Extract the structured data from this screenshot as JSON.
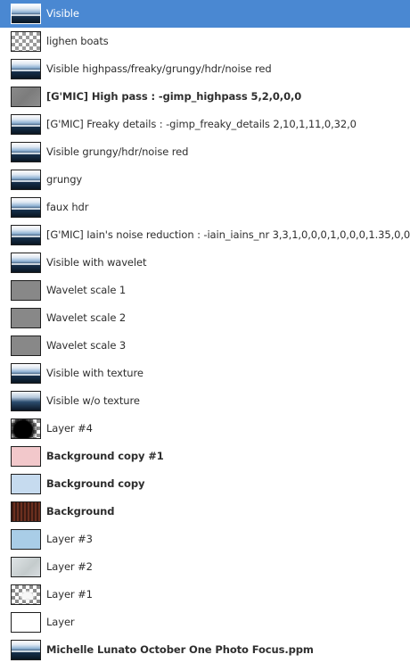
{
  "layers": [
    {
      "name": "Visible",
      "bold": false,
      "selected": true,
      "thumb": "t-photo"
    },
    {
      "name": "lighen boats",
      "bold": false,
      "selected": false,
      "thumb": "t-check"
    },
    {
      "name": "Visible highpass/freaky/grungy/hdr/noise red",
      "bold": false,
      "selected": false,
      "thumb": "t-photo"
    },
    {
      "name": "[G'MIC] High pass : -gimp_highpass 5,2,0,0,0",
      "bold": true,
      "selected": false,
      "thumb": "t-gray-noise"
    },
    {
      "name": "[G'MIC] Freaky details : -gimp_freaky_details 2,10,1,11,0,32,0",
      "bold": false,
      "selected": false,
      "thumb": "t-photo"
    },
    {
      "name": "Visible grungy/hdr/noise red",
      "bold": false,
      "selected": false,
      "thumb": "t-photo"
    },
    {
      "name": "grungy",
      "bold": false,
      "selected": false,
      "thumb": "t-photo"
    },
    {
      "name": "faux hdr",
      "bold": false,
      "selected": false,
      "thumb": "t-photo"
    },
    {
      "name": "[G'MIC] Iain's noise reduction : -iain_iains_nr 3,3,1,0,0,0,1,0,0,0,1.35,0,0",
      "bold": false,
      "selected": false,
      "thumb": "t-photo"
    },
    {
      "name": "Visible with wavelet",
      "bold": false,
      "selected": false,
      "thumb": "t-photo"
    },
    {
      "name": "Wavelet scale 1",
      "bold": false,
      "selected": false,
      "thumb": "t-gray"
    },
    {
      "name": "Wavelet scale 2",
      "bold": false,
      "selected": false,
      "thumb": "t-gray"
    },
    {
      "name": "Wavelet scale 3",
      "bold": false,
      "selected": false,
      "thumb": "t-gray"
    },
    {
      "name": "Visible with texture",
      "bold": false,
      "selected": false,
      "thumb": "t-photo"
    },
    {
      "name": "Visible w/o texture",
      "bold": false,
      "selected": false,
      "thumb": "t-dark-photo"
    },
    {
      "name": "Layer #4",
      "bold": false,
      "selected": false,
      "thumb": "t-blackcheck"
    },
    {
      "name": "Background copy #1",
      "bold": true,
      "selected": false,
      "thumb": "t-pink"
    },
    {
      "name": "Background copy",
      "bold": true,
      "selected": false,
      "thumb": "t-lightblue"
    },
    {
      "name": "Background",
      "bold": true,
      "selected": false,
      "thumb": "t-bark"
    },
    {
      "name": "Layer #3",
      "bold": false,
      "selected": false,
      "thumb": "t-sky"
    },
    {
      "name": "Layer #2",
      "bold": false,
      "selected": false,
      "thumb": "t-mist"
    },
    {
      "name": "Layer #1",
      "bold": false,
      "selected": false,
      "thumb": "t-cloudcheck"
    },
    {
      "name": "Layer",
      "bold": false,
      "selected": false,
      "thumb": "t-white"
    },
    {
      "name": "Michelle Lunato October One Photo Focus.ppm",
      "bold": true,
      "selected": false,
      "thumb": "t-photo"
    }
  ],
  "colors": {
    "selection_background": "#4a88d2",
    "selection_text": "#ffffff",
    "text": "#2e2e2e"
  }
}
